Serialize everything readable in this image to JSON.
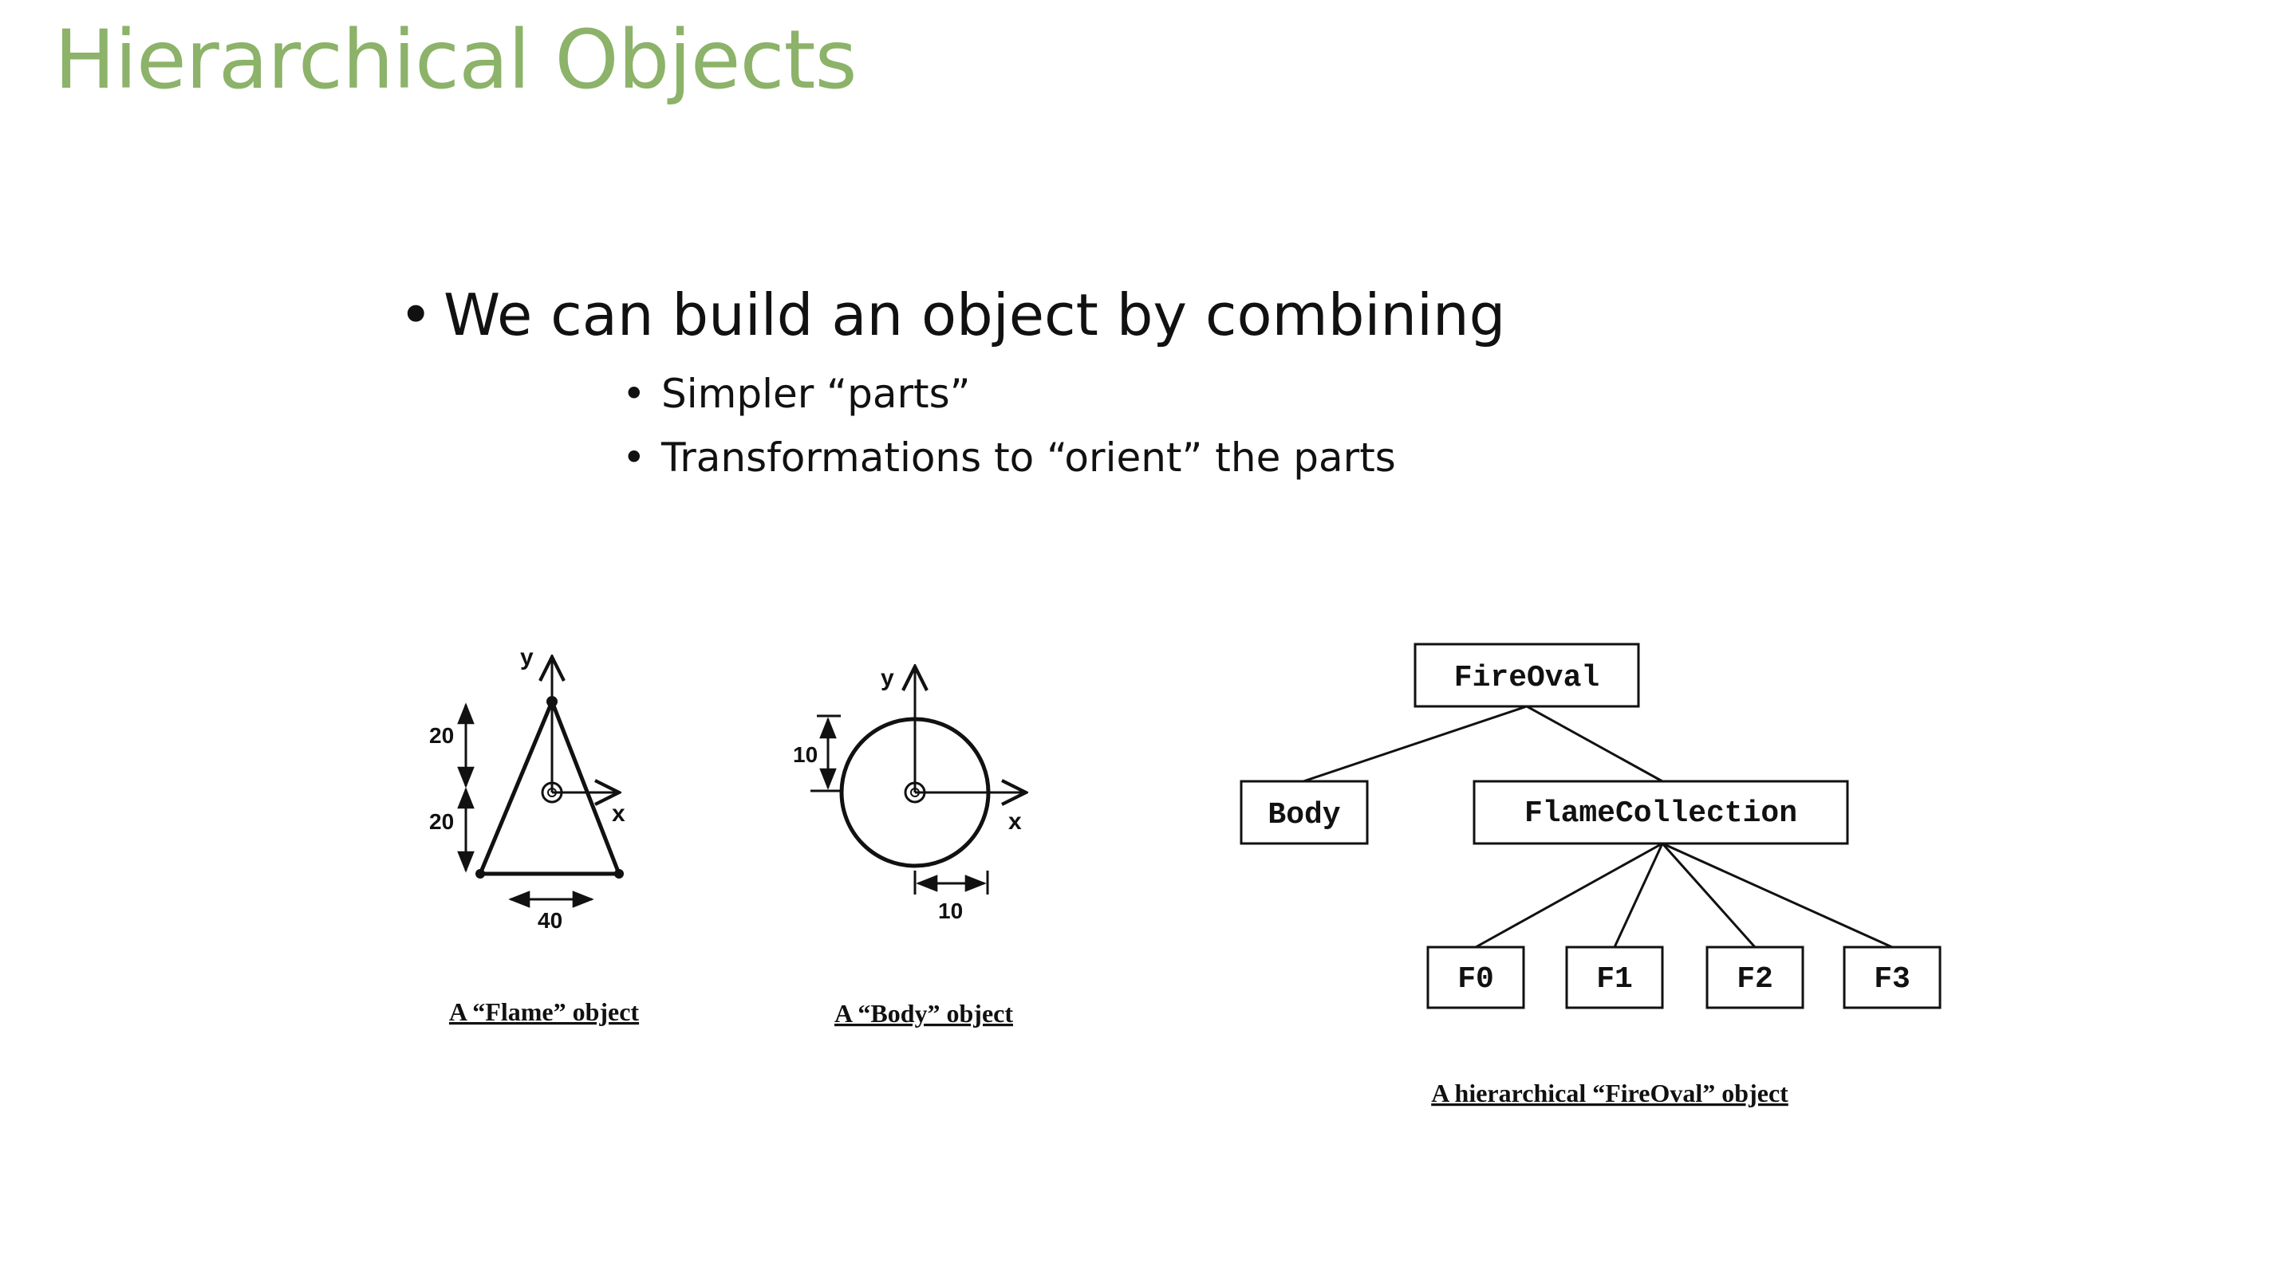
{
  "slide": {
    "title": "Hierarchical Objects",
    "title_color": "#8cb369"
  },
  "bullets": {
    "main": "We can build an object by combining",
    "sub": [
      "Simpler “parts”",
      "Transformations to “orient” the parts"
    ]
  },
  "flame_figure": {
    "axis_x": "x",
    "axis_y": "y",
    "height_upper": "20",
    "height_lower": "20",
    "base_width": "40",
    "caption": "A “Flame” object"
  },
  "body_figure": {
    "axis_x": "x",
    "axis_y": "y",
    "radius_vertical": "10",
    "radius_horizontal": "10",
    "caption": "A “Body” object"
  },
  "tree": {
    "root": "FireOval",
    "body": "Body",
    "flame_collection": "FlameCollection",
    "flames": [
      "F0",
      "F1",
      "F2",
      "F3"
    ],
    "caption": "A hierarchical “FireOval” object"
  }
}
